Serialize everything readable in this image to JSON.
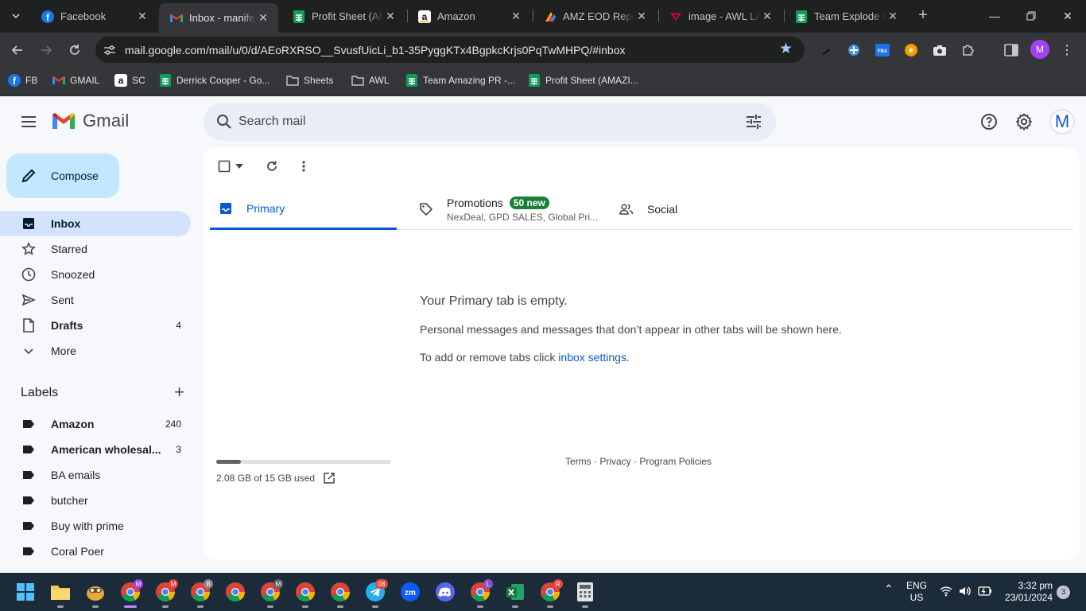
{
  "browser": {
    "tabs": [
      {
        "title": "Facebook"
      },
      {
        "title": "Inbox - manifest"
      },
      {
        "title": "Profit Sheet (AMAZ"
      },
      {
        "title": "Amazon"
      },
      {
        "title": "AMZ EOD Report"
      },
      {
        "title": "image - AWL LAB"
      },
      {
        "title": "Team Explode Pr"
      }
    ],
    "url": "mail.google.com/mail/u/0/d/AEoRXRSO__SvusfUicLi_b1-35PyggKTx4BgpkcKrjs0PqTwMHPQ/#inbox",
    "profile_initial": "M",
    "bookmarks": [
      {
        "label": "FB"
      },
      {
        "label": "GMAIL"
      },
      {
        "label": "SC"
      },
      {
        "label": "Derrick Cooper - Go..."
      },
      {
        "label": "Sheets"
      },
      {
        "label": "AWL"
      },
      {
        "label": "Team Amazing PR -..."
      },
      {
        "label": "Profit Sheet (AMAZI..."
      }
    ],
    "ext_fba_label": "FBA"
  },
  "gmail": {
    "logo_text": "Gmail",
    "search_placeholder": "Search mail",
    "avatar_initial": "M",
    "compose_label": "Compose",
    "nav": [
      {
        "label": "Inbox",
        "count": ""
      },
      {
        "label": "Starred",
        "count": ""
      },
      {
        "label": "Snoozed",
        "count": ""
      },
      {
        "label": "Sent",
        "count": ""
      },
      {
        "label": "Drafts",
        "count": "4"
      },
      {
        "label": "More",
        "count": ""
      }
    ],
    "labels_title": "Labels",
    "labels": [
      {
        "name": "Amazon",
        "count": "240"
      },
      {
        "name": "American wholesal...",
        "count": "3"
      },
      {
        "name": "BA emails",
        "count": ""
      },
      {
        "name": "butcher",
        "count": ""
      },
      {
        "name": "Buy with prime",
        "count": ""
      },
      {
        "name": "Coral Poer",
        "count": ""
      }
    ],
    "tabs": {
      "primary": "Primary",
      "promotions": "Promotions",
      "promotions_badge": "50 new",
      "promotions_sub": "NexDeal, GPD SALES, Global Pri...",
      "social": "Social"
    },
    "empty": {
      "title": "Your Primary tab is empty.",
      "desc": "Personal messages and messages that don’t appear in other tabs will be shown here.",
      "tip_prefix": "To add or remove tabs click ",
      "tip_link": "inbox settings",
      "tip_suffix": "."
    },
    "storage": {
      "text": "2.08 GB of 15 GB used",
      "fraction": 0.139
    },
    "footer": {
      "terms": "Terms",
      "privacy": "Privacy",
      "policies": "Program Policies",
      "sep": " · "
    }
  },
  "taskbar": {
    "badges": {
      "chrome1": "M",
      "chrome2": "M",
      "chrome3": "B",
      "chrome5": "M",
      "telegram": "08",
      "chrome_l": "L",
      "chrome_r": "R"
    },
    "zoom_label": "zm",
    "lang": "ENG",
    "region": "US",
    "time": "3:32 pm",
    "date": "23/01/2024",
    "notifications": "3"
  },
  "colors": {
    "accent": "#0b57d0",
    "compose_bg": "#c2e7ff",
    "active_nav_bg": "#d3e3fd",
    "badge_green": "#188038",
    "chrome_dark": "#35363a"
  }
}
